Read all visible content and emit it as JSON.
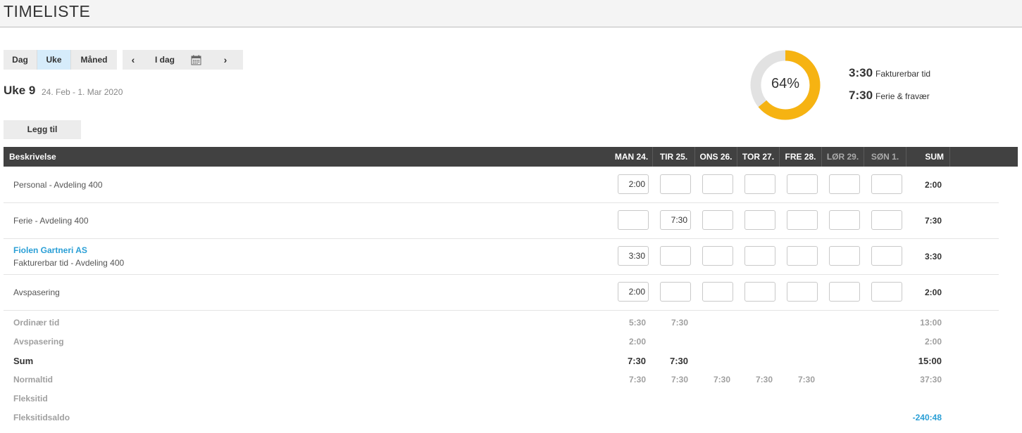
{
  "page": {
    "title": "TIMELISTE"
  },
  "views": [
    {
      "label": "Dag",
      "active": false
    },
    {
      "label": "Uke",
      "active": true
    },
    {
      "label": "Måned",
      "active": false
    }
  ],
  "nav": {
    "prev": "‹",
    "today": "I dag",
    "calendar_icon": "calendar-icon",
    "next": "›"
  },
  "week": {
    "title": "Uke 9",
    "range": "24. Feb - 1. Mar 2020"
  },
  "add_label": "Legg til",
  "chart_data": {
    "type": "pie",
    "label": "64%",
    "values": [
      64,
      36
    ],
    "colors": [
      "#f6b312",
      "#e2e2e2"
    ]
  },
  "legend": [
    {
      "value": "3:30",
      "label": "Fakturerbar tid"
    },
    {
      "value": "7:30",
      "label": "Ferie & fravær"
    }
  ],
  "table": {
    "headers": [
      "Beskrivelse",
      "MAN 24.",
      "TIR 25.",
      "ONS 26.",
      "TOR 27.",
      "FRE 28.",
      "LØR 29.",
      "SØN 1.",
      "SUM"
    ],
    "rows": [
      {
        "label": "Personal - Avdeling 400",
        "link": "",
        "cells": [
          "2:00",
          "",
          "",
          "",
          "",
          "",
          ""
        ],
        "sum": "2:00"
      },
      {
        "label": "Ferie - Avdeling 400",
        "link": "",
        "cells": [
          "",
          "7:30",
          "",
          "",
          "",
          "",
          ""
        ],
        "sum": "7:30"
      },
      {
        "label": "Fakturerbar tid - Avdeling 400",
        "link": "Fiolen Gartneri AS",
        "cells": [
          "3:30",
          "",
          "",
          "",
          "",
          "",
          ""
        ],
        "sum": "3:30"
      },
      {
        "label": "Avspasering",
        "link": "",
        "cells": [
          "2:00",
          "",
          "",
          "",
          "",
          "",
          ""
        ],
        "sum": "2:00"
      }
    ]
  },
  "summary": [
    {
      "label": "Ordinær tid",
      "values": [
        "5:30",
        "7:30",
        "",
        "",
        "",
        "",
        ""
      ],
      "total": "13:00"
    },
    {
      "label": "Avspasering",
      "values": [
        "2:00",
        "",
        "",
        "",
        "",
        "",
        ""
      ],
      "total": "2:00"
    },
    {
      "label": "Sum",
      "values": [
        "7:30",
        "7:30",
        "",
        "",
        "",
        "",
        ""
      ],
      "total": "15:00"
    },
    {
      "label": "Normaltid",
      "values": [
        "7:30",
        "7:30",
        "7:30",
        "7:30",
        "7:30",
        "",
        ""
      ],
      "total": "37:30"
    },
    {
      "label": "Fleksitid",
      "values": [
        "",
        "",
        "",
        "",
        "",
        "",
        ""
      ],
      "total": ""
    },
    {
      "label": "Fleksitidsaldo",
      "values": [
        "",
        "",
        "",
        "",
        "",
        "",
        ""
      ],
      "total": "-240:48"
    }
  ]
}
